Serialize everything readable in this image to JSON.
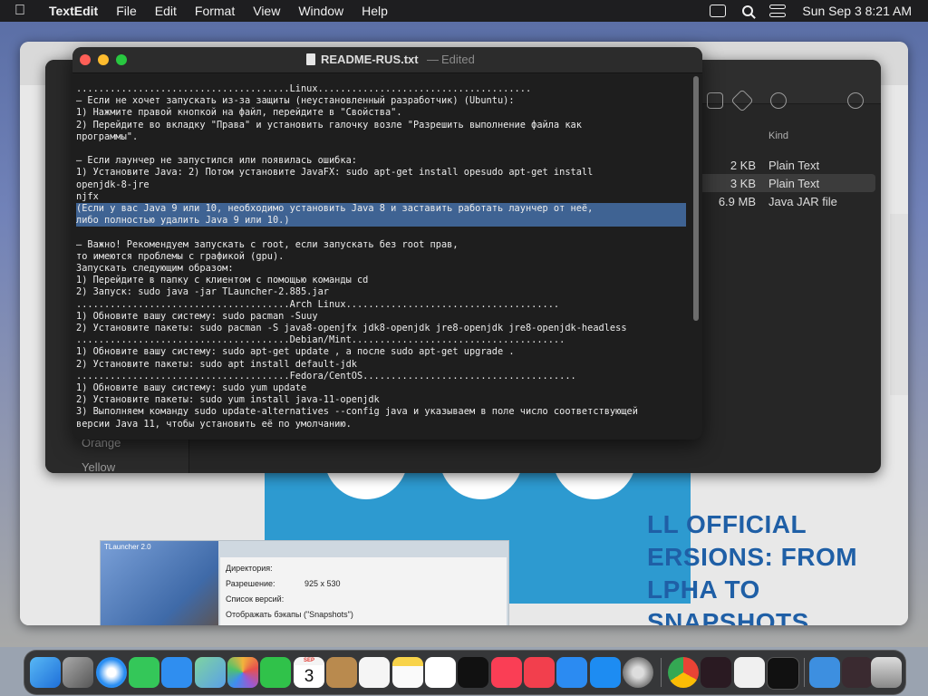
{
  "menubar": {
    "app": "TextEdit",
    "items": [
      "File",
      "Edit",
      "Format",
      "View",
      "Window",
      "Help"
    ],
    "clock": "Sun Sep 3  8:21 AM"
  },
  "textedit": {
    "title": "README-RUS.txt",
    "separator": "—",
    "status": "Edited",
    "lines": [
      "......................................Linux......................................",
      "— Если не хочет запускать из-за защиты (неустановленный разработчик) (Ubuntu):",
      "1) Нажмите правой кнопкой на файл, перейдите в \"Свойства\".",
      "2) Перейдите во вкладку \"Права\" и установить галочку возле \"Разрешить выполнение файла как",
      "программы\".",
      "",
      "— Если лаунчер не запустился или появилась ошибка:",
      "1) Установите Java: 2) Потом установите JavaFX: sudo apt-get install opesudo apt-get install",
      "openjdk-8-jre",
      "njfx",
      "(Если у вас Java 9 или 10, необходимо установить Java 8 и заставить работать лаунчер от неё,",
      "либо полностью удалить Java 9 или 10.)",
      "",
      "— Важно! Рекомендуем запускать с root, если запускать без root прав,",
      "то имеются проблемы с графикой (gpu).",
      "Запускать следующим образом:",
      "1) Перейдите в папку с клиентом с помощью команды cd",
      "2) Запуск: sudo java -jar TLauncher-2.885.jar",
      "......................................Arch Linux......................................",
      "1) Обновите вашу систему: sudo pacman -Suuy",
      "2) Установите пакеты: sudo pacman -S java8-openjfx jdk8-openjdk jre8-openjdk jre8-openjdk-headless",
      "......................................Debian/Mint......................................",
      "1) Обновите вашу систему: sudo apt-get update , а после sudo apt-get upgrade .",
      "2) Установите пакеты: sudo apt install default-jdk",
      "......................................Fedora/CentOS......................................",
      "1) Обновите вашу систему: sudo yum update",
      "2) Установите пакеты: sudo yum install java-11-openjdk",
      "3) Выполняем команду sudo update-alternatives --config java и указываем в поле число соответствующей",
      "версии Java 11, чтобы установить её по умолчанию."
    ]
  },
  "finder": {
    "column_kind": "Kind",
    "rows": [
      {
        "size": "2 KB",
        "kind": "Plain Text"
      },
      {
        "size": "3 KB",
        "kind": "Plain Text"
      },
      {
        "size": "6.9 MB",
        "kind": "Java JAR file"
      }
    ],
    "sidebar_tags": [
      "Orange",
      "Yellow"
    ]
  },
  "browser": {
    "promo_lines": [
      "LL OFFICIAL",
      "ERSIONS: FROM",
      "LPHA TO",
      "SNAPSHOTS"
    ],
    "form_labels": [
      "Директория:",
      "Разрешение:",
      "Список версий:"
    ],
    "form_values": [
      "925",
      "530"
    ],
    "form_checkbox": "Отображать бэкапы (\"Snapshots\")",
    "window_label": "TLauncher 2.0"
  },
  "dock": {
    "calendar_month": "SEP",
    "calendar_day": "3"
  }
}
